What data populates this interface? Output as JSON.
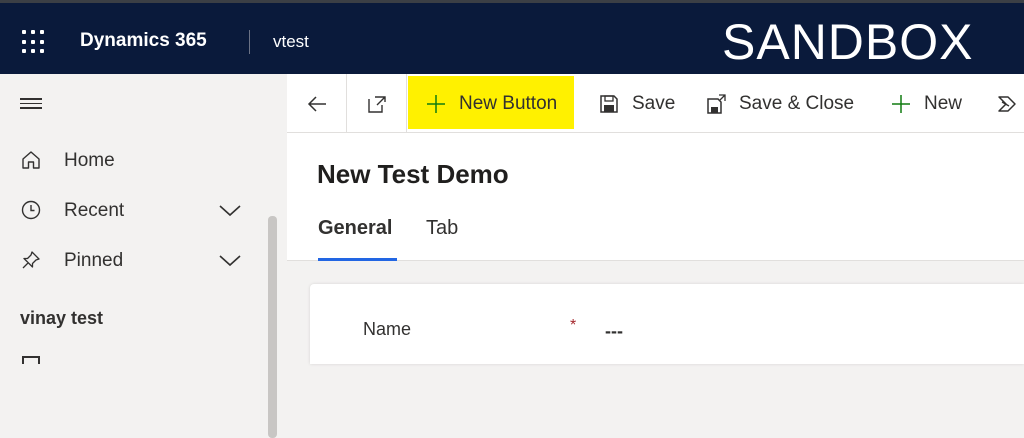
{
  "topbar": {
    "brand": "Dynamics 365",
    "app_name": "vtest",
    "environment": "SANDBOX",
    "icons": {
      "app_launcher": "waffle-icon"
    }
  },
  "sidebar": {
    "icons": {
      "menu": "hamburger-icon"
    },
    "items": [
      {
        "label": "Home",
        "icon": "home-icon",
        "has_chevron": false
      },
      {
        "label": "Recent",
        "icon": "clock-icon",
        "has_chevron": true
      },
      {
        "label": "Pinned",
        "icon": "pin-icon",
        "has_chevron": true
      }
    ],
    "group_label": "vinay test"
  },
  "commandbar": {
    "icons": {
      "back": "back-arrow-icon",
      "popout": "popout-icon"
    },
    "items": [
      {
        "label": "New Button",
        "icon": "plus-icon"
      },
      {
        "label": "Save",
        "icon": "save-icon"
      },
      {
        "label": "Save & Close",
        "icon": "save-close-icon"
      },
      {
        "label": "New",
        "icon": "plus-icon"
      }
    ],
    "highlight_color": "#fff100"
  },
  "form": {
    "title": "New Test Demo",
    "tabs": [
      {
        "label": "General",
        "active": true
      },
      {
        "label": "Tab",
        "active": false
      }
    ],
    "fields": [
      {
        "label": "Name",
        "required_marker": "*",
        "value": "---"
      }
    ]
  },
  "colors": {
    "topbar_bg": "#0a1a3b",
    "accent": "#2266e3",
    "plus_green": "#107c10",
    "required_red": "#a4262c"
  }
}
